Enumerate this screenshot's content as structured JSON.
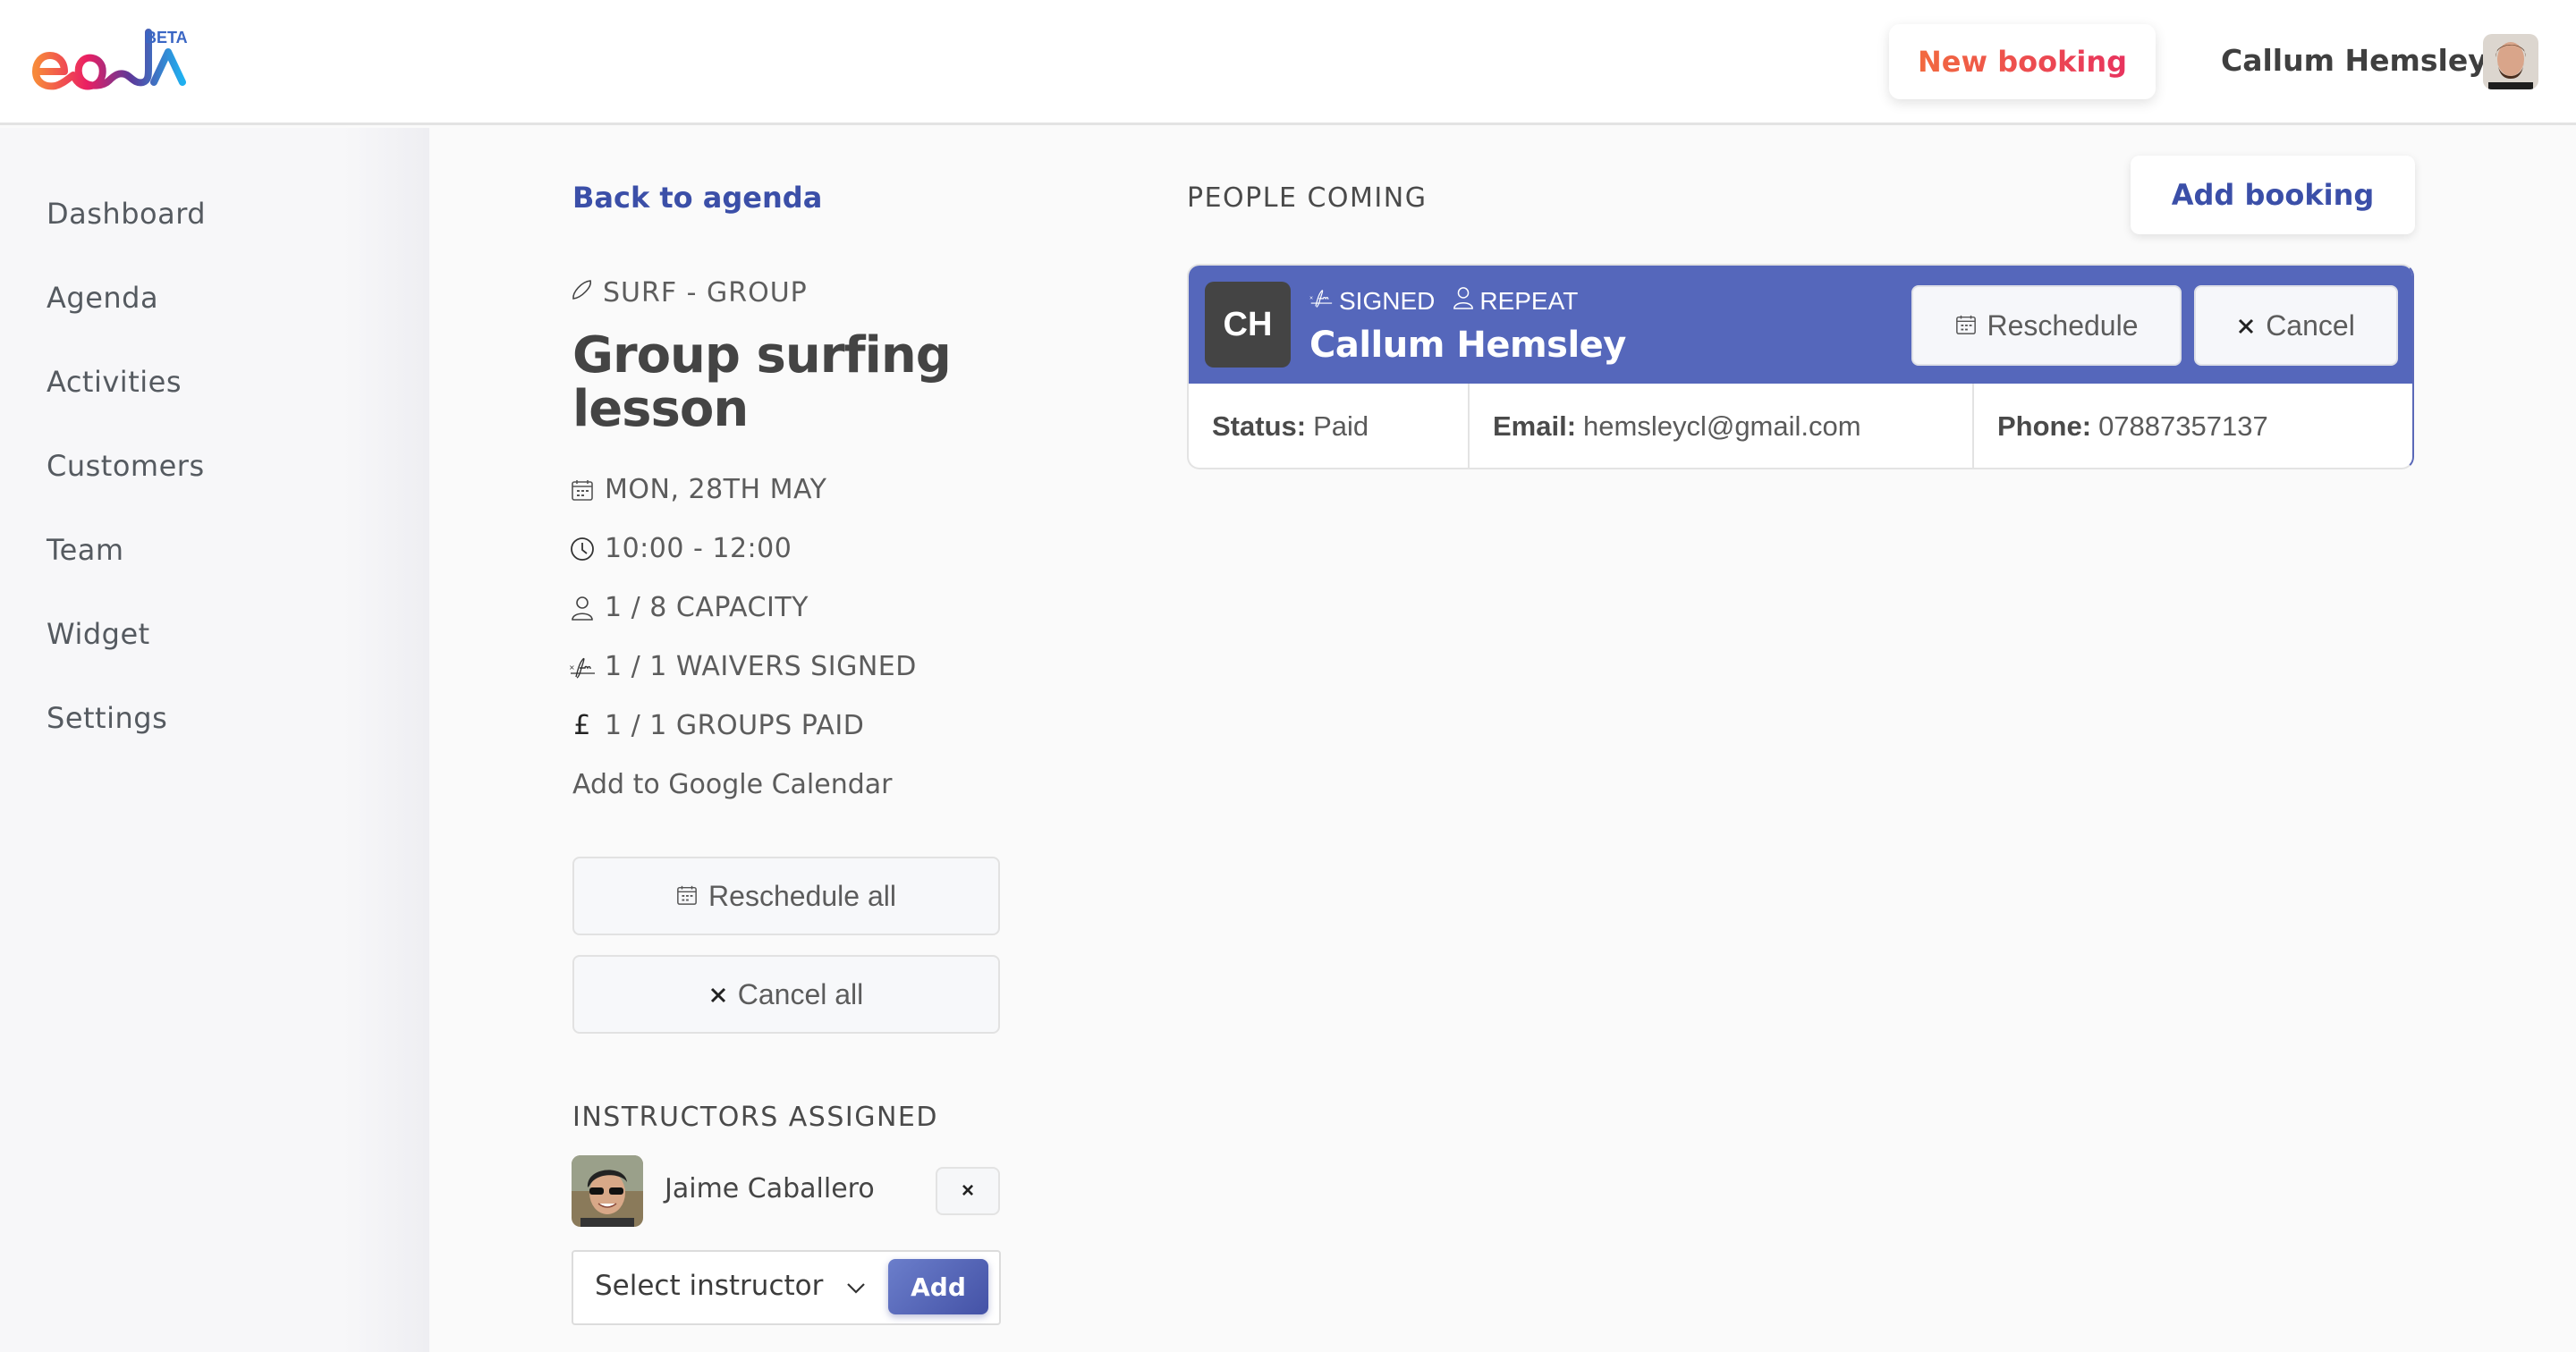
{
  "header": {
    "logo_text": "eola",
    "logo_badge": "BETA",
    "new_booking_label": "New booking",
    "user_name": "Callum Hemsley"
  },
  "sidebar": {
    "items": [
      {
        "label": "Dashboard"
      },
      {
        "label": "Agenda"
      },
      {
        "label": "Activities"
      },
      {
        "label": "Customers"
      },
      {
        "label": "Team"
      },
      {
        "label": "Widget"
      },
      {
        "label": "Settings"
      }
    ]
  },
  "event": {
    "back_label": "Back to agenda",
    "activity_type": "SURF - GROUP",
    "title": "Group surfing lesson",
    "date": "MON, 28TH MAY",
    "time": "10:00 - 12:00",
    "capacity": "1 / 8 CAPACITY",
    "waivers": "1 / 1 WAIVERS SIGNED",
    "payments": "1 / 1 GROUPS PAID",
    "currency_symbol": "£",
    "google_calendar_label": "Add to Google Calendar",
    "reschedule_all_label": "Reschedule all",
    "cancel_all_label": "Cancel all"
  },
  "instructors": {
    "section_label": "INSTRUCTORS ASSIGNED",
    "assigned": [
      {
        "name": "Jaime Caballero"
      }
    ],
    "remove_label": "×",
    "select_placeholder": "Select instructor",
    "add_label": "Add"
  },
  "people": {
    "section_label": "PEOPLE COMING",
    "add_booking_label": "Add booking",
    "bookings": [
      {
        "initials": "CH",
        "badges": [
          "SIGNED",
          "REPEAT"
        ],
        "name": "Callum Hemsley",
        "reschedule_label": "Reschedule",
        "cancel_label": "Cancel",
        "status_label": "Status:",
        "status": "Paid",
        "email_label": "Email:",
        "email": "hemsleycl@gmail.com",
        "phone_label": "Phone:",
        "phone": "07887357137"
      }
    ]
  },
  "colors": {
    "brand_blue": "#3b4fa8",
    "card_header": "#5567bb",
    "new_booking_gradient": [
      "#f26a3f",
      "#e8335e"
    ]
  }
}
